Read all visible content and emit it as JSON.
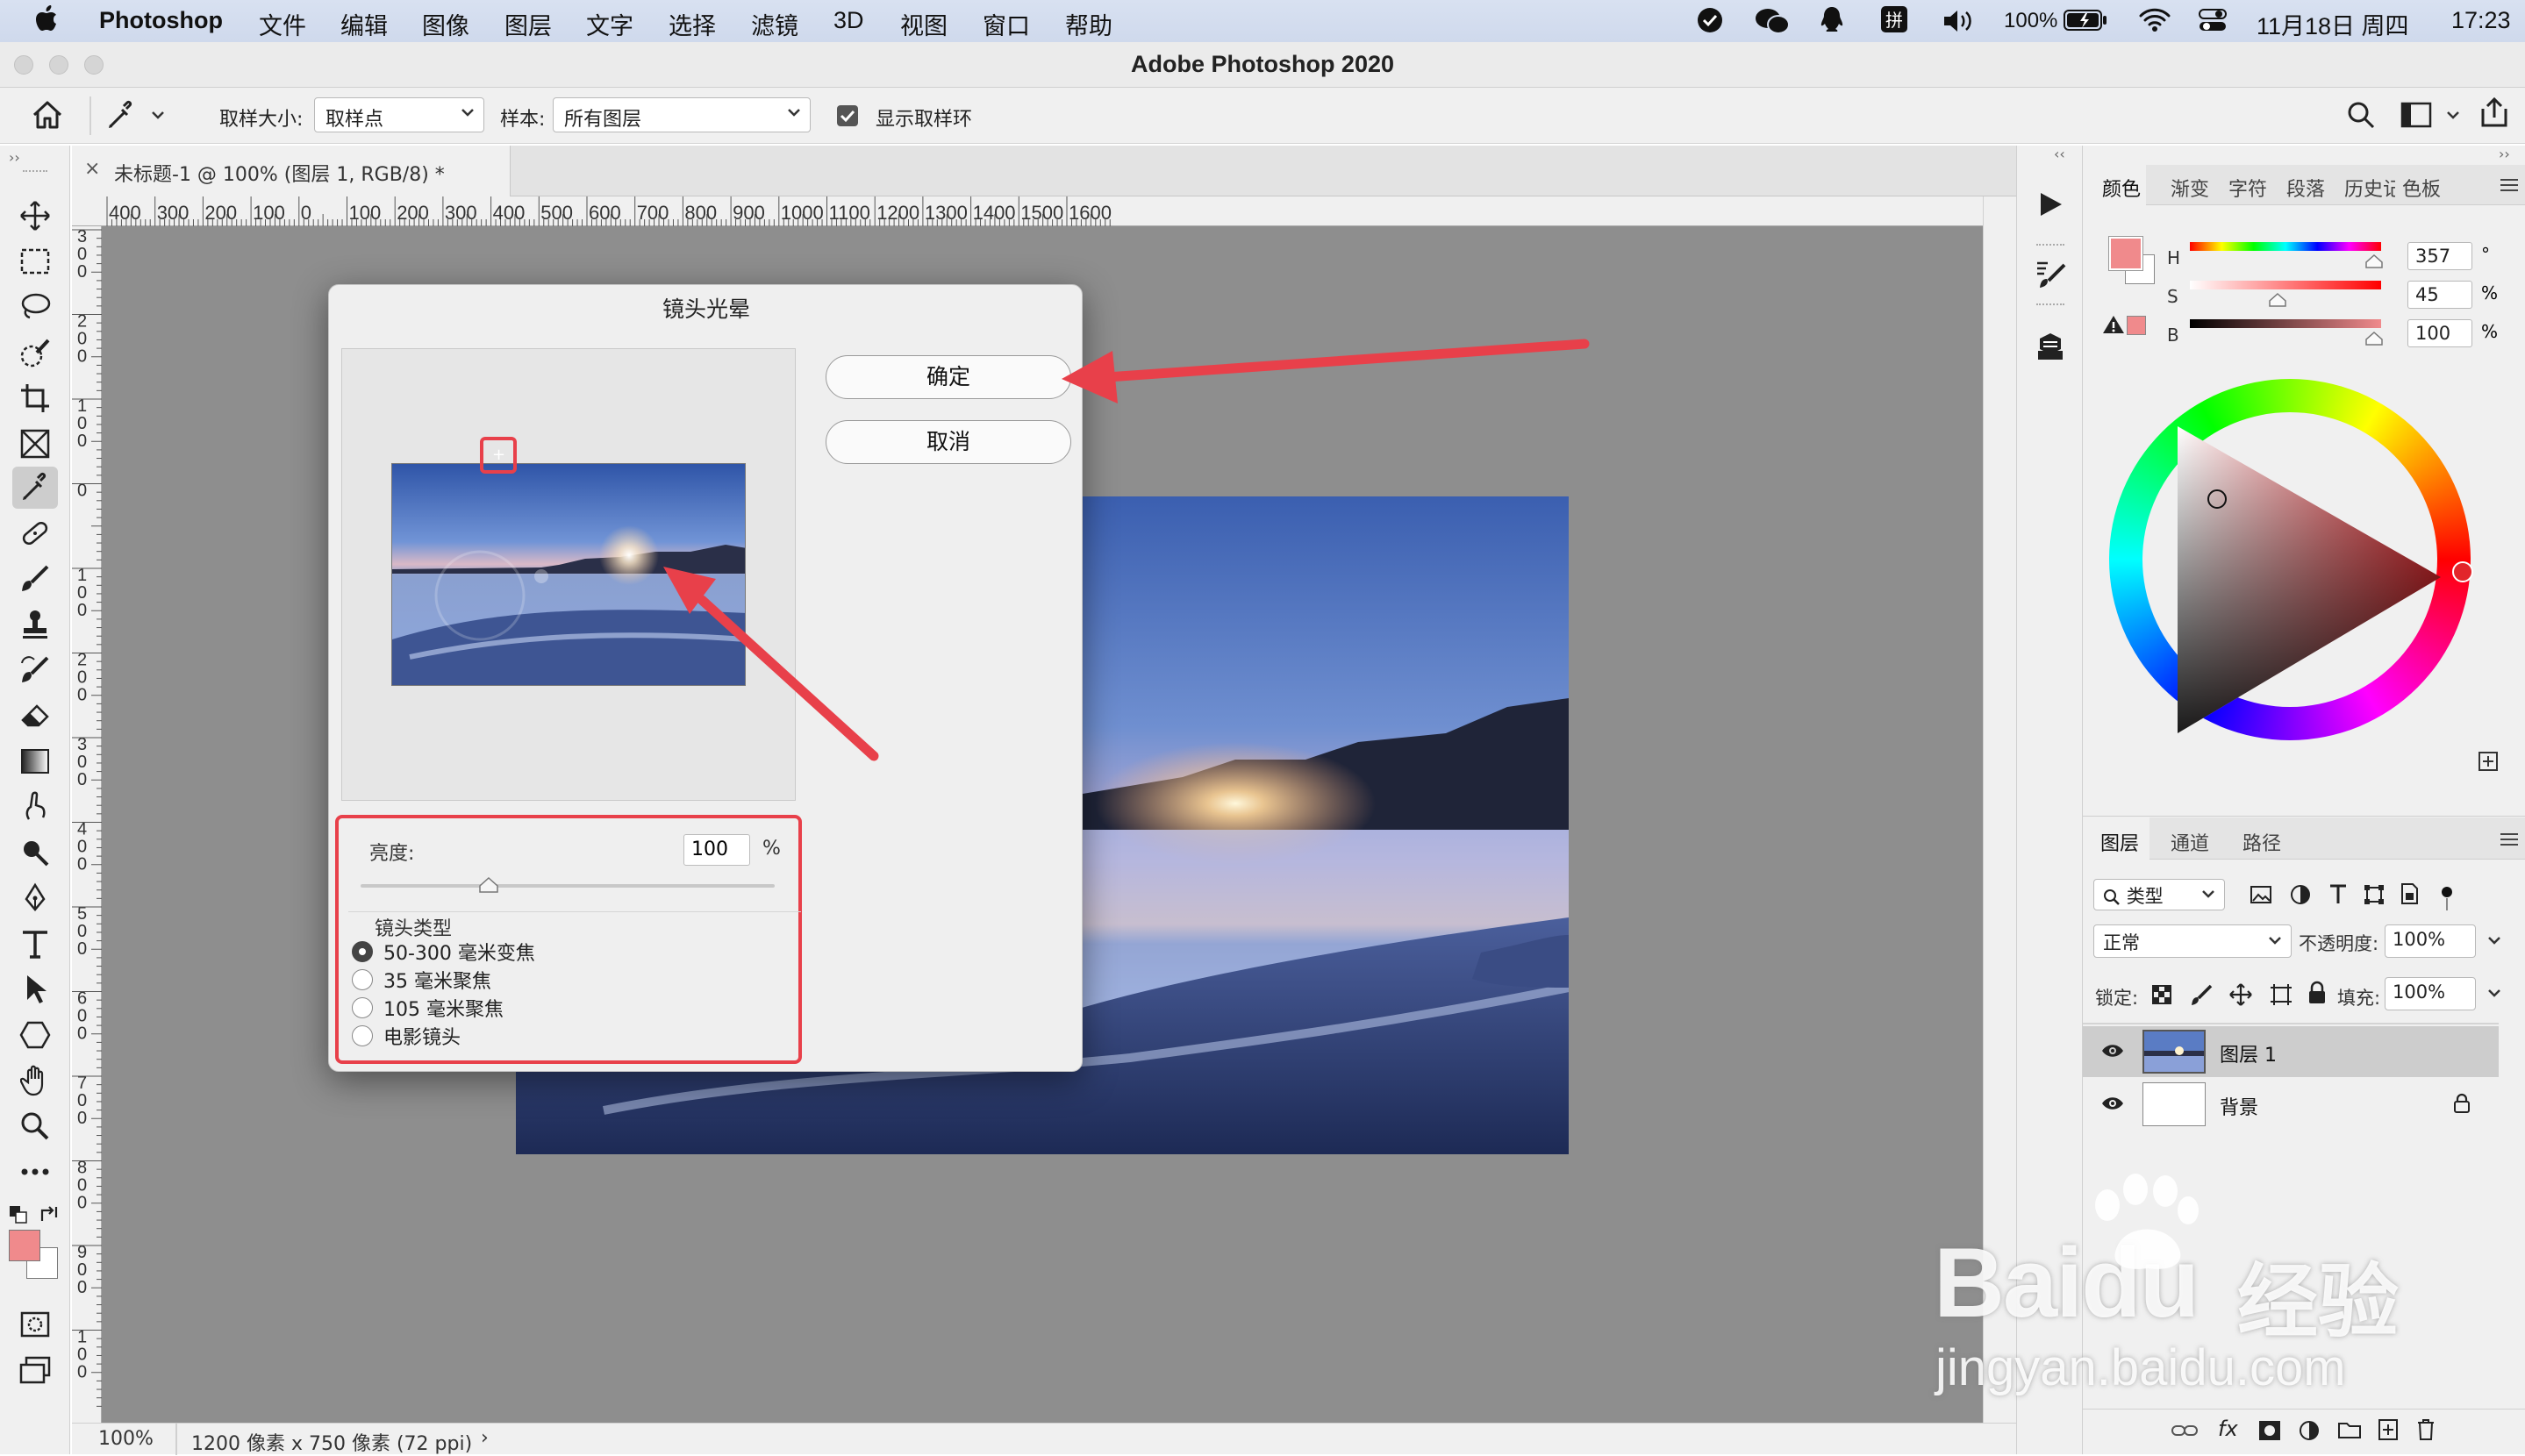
{
  "menubar": {
    "app": "Photoshop",
    "items": [
      "文件",
      "编辑",
      "图像",
      "图层",
      "文字",
      "选择",
      "滤镜",
      "3D",
      "视图",
      "窗口",
      "帮助"
    ],
    "battery": "100%",
    "date": "11月18日 周四",
    "time": "17:23"
  },
  "window": {
    "title": "Adobe Photoshop 2020"
  },
  "options": {
    "sample_size_label": "取样大小:",
    "sample_size_value": "取样点",
    "sample_label": "样本:",
    "sample_value": "所有图层",
    "show_ring_label": "显示取样环",
    "show_ring_checked": true
  },
  "document": {
    "tab_title": "未标题-1 @ 100% (图层 1, RGB/8) *",
    "ruler_h": [
      "400",
      "300",
      "200",
      "100",
      "0",
      "100",
      "200",
      "300",
      "400",
      "500",
      "600",
      "700",
      "800",
      "900",
      "1000",
      "1100",
      "1200",
      "1300",
      "1400",
      "1500",
      "1600"
    ],
    "ruler_v": [
      "3\n0\n0",
      "2\n0\n0",
      "1\n0\n0",
      "0",
      "1\n0\n0",
      "2\n0\n0",
      "3\n0\n0",
      "4\n0\n0",
      "5\n0\n0",
      "6\n0\n0",
      "7\n0\n0",
      "8\n0\n0",
      "9\n0\n0",
      "1\n0\n0"
    ],
    "zoom": "100%",
    "info": "1200 像素 x 750 像素 (72 ppi)"
  },
  "dialog": {
    "title": "镜头光晕",
    "ok": "确定",
    "cancel": "取消",
    "brightness_label": "亮度:",
    "brightness_value": "100",
    "brightness_unit": "%",
    "brightness_level": 100,
    "lens_type_label": "镜头类型",
    "lens_types": [
      "50-300 毫米变焦",
      "35 毫米聚焦",
      "105 毫米聚焦",
      "电影镜头"
    ],
    "selected_lens": 0
  },
  "color_panel": {
    "tabs": [
      "颜色",
      "渐变",
      "字符",
      "段落",
      "历史记",
      "色板"
    ],
    "h_label": "H",
    "s_label": "S",
    "b_label": "B",
    "h_value": "357",
    "s_value": "45",
    "b_value": "100",
    "h_unit": "°",
    "s_unit": "%",
    "b_unit": "%",
    "fg_color": "#f08a8c"
  },
  "layers_panel": {
    "tabs": [
      "图层",
      "通道",
      "路径"
    ],
    "filter_type": "类型",
    "blend_mode": "正常",
    "opacity_label": "不透明度:",
    "opacity_value": "100%",
    "lock_label": "锁定:",
    "fill_label": "填充:",
    "fill_value": "100%",
    "layers": [
      {
        "name": "图层 1",
        "selected": true
      },
      {
        "name": "背景",
        "locked": true
      }
    ]
  },
  "watermark": {
    "brand": "Baidu",
    "brand_cn": "经验",
    "url": "jingyan.baidu.com"
  }
}
